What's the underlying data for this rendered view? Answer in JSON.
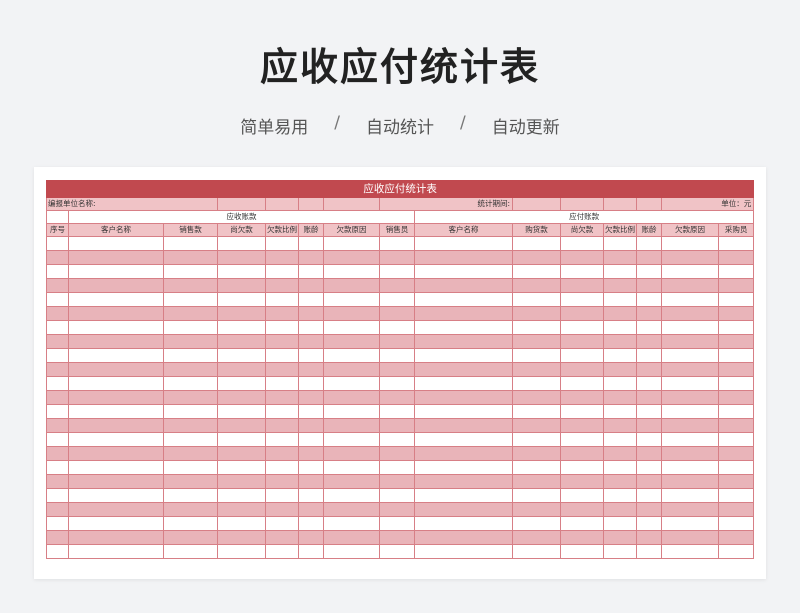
{
  "page": {
    "title": "应收应付统计表",
    "features": [
      "简单易用",
      "自动统计",
      "自动更新"
    ],
    "separator": "/"
  },
  "sheet": {
    "title": "应收应付统计表",
    "info": {
      "compiler_label": "编报单位名称:",
      "period_label": "统计期间:",
      "unit_label": "单位：元"
    },
    "sections": {
      "receivable": "应收账款",
      "payable": "应付账款"
    },
    "columns": [
      "序号",
      "客户名称",
      "销售款",
      "尚欠款",
      "欠款比例",
      "账龄",
      "欠款原因",
      "销售员",
      "客户名称",
      "购货款",
      "尚欠款",
      "欠款比例",
      "账龄",
      "欠款原因",
      "采购员"
    ],
    "empty_rows": 23
  },
  "colors": {
    "title_bar": "#c1494f",
    "stripe": "#e9b4b9",
    "header_fill": "#f0c3c6",
    "border": "#d77f86"
  }
}
